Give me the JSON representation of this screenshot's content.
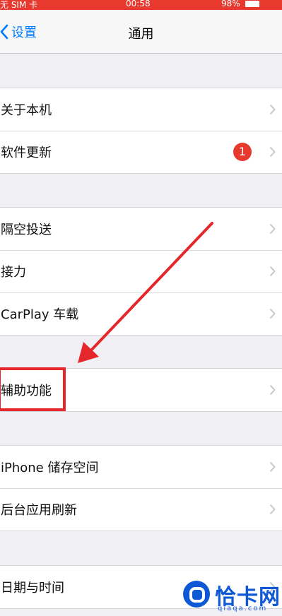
{
  "status_bar": {
    "carrier": "无 SIM 卡",
    "time": "00:58",
    "battery": "98%",
    "color": "#e8392f"
  },
  "nav": {
    "back_label": "设置",
    "title": "通用",
    "accent": "#007aff"
  },
  "groups": [
    {
      "rows": [
        {
          "label": "关于本机"
        },
        {
          "label": "软件更新",
          "badge": "1"
        }
      ]
    },
    {
      "rows": [
        {
          "label": "隔空投送"
        },
        {
          "label": "接力"
        },
        {
          "label": "CarPlay 车载"
        }
      ]
    },
    {
      "rows": [
        {
          "label": "辅助功能",
          "highlighted": true
        }
      ]
    },
    {
      "rows": [
        {
          "label": "iPhone 储存空间"
        },
        {
          "label": "后台应用刷新"
        }
      ]
    },
    {
      "rows": [
        {
          "label": "日期与时间"
        }
      ]
    }
  ],
  "watermark": {
    "text": "恰卡网",
    "sub": "qiaqa.com",
    "color": "#0e58d6"
  },
  "annotation": {
    "color": "#e5262b"
  }
}
